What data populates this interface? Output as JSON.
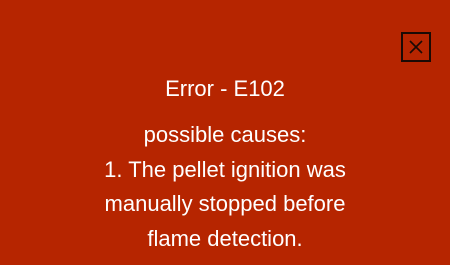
{
  "dialog": {
    "close_icon": "close-x-icon",
    "title": "Error - E102",
    "causes_heading": "possible causes:",
    "cause_lines": [
      "1. The pellet ignition was",
      "manually stopped before",
      "flame detection."
    ],
    "colors": {
      "background": "#b62500",
      "text": "#ffffff",
      "close_border": "#1a0a05"
    }
  }
}
